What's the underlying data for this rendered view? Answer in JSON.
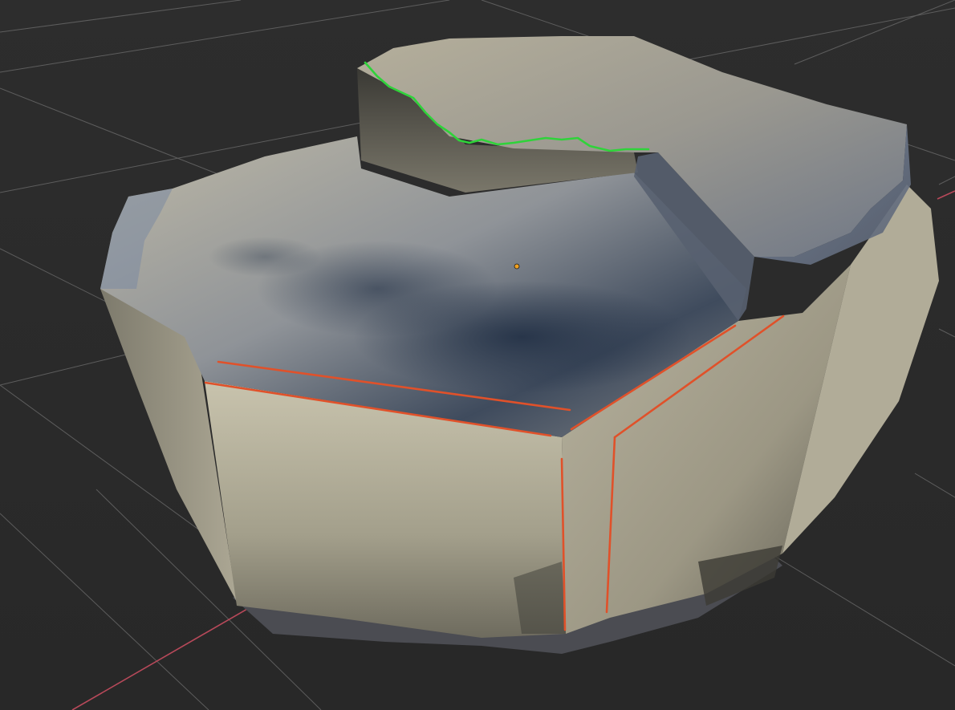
{
  "viewport": {
    "kind": "3d-viewport",
    "background_color": "#2b2b2b",
    "grid_color": "#6e6e6e",
    "x_axis_color": "#b8495a",
    "object": {
      "name_shown": "",
      "material_colors": {
        "stone_light": "#b7b19d",
        "stone_mid": "#8d8a7a",
        "stone_dark": "#3c3b35",
        "shadow_blue": "#3e4a5c",
        "edge_glass": "#7b8aa2"
      }
    },
    "annotations": {
      "orange_marker_color": "#e0512a",
      "green_marker_color": "#2fd33a",
      "origin_dot_color": "#f0a020"
    }
  }
}
